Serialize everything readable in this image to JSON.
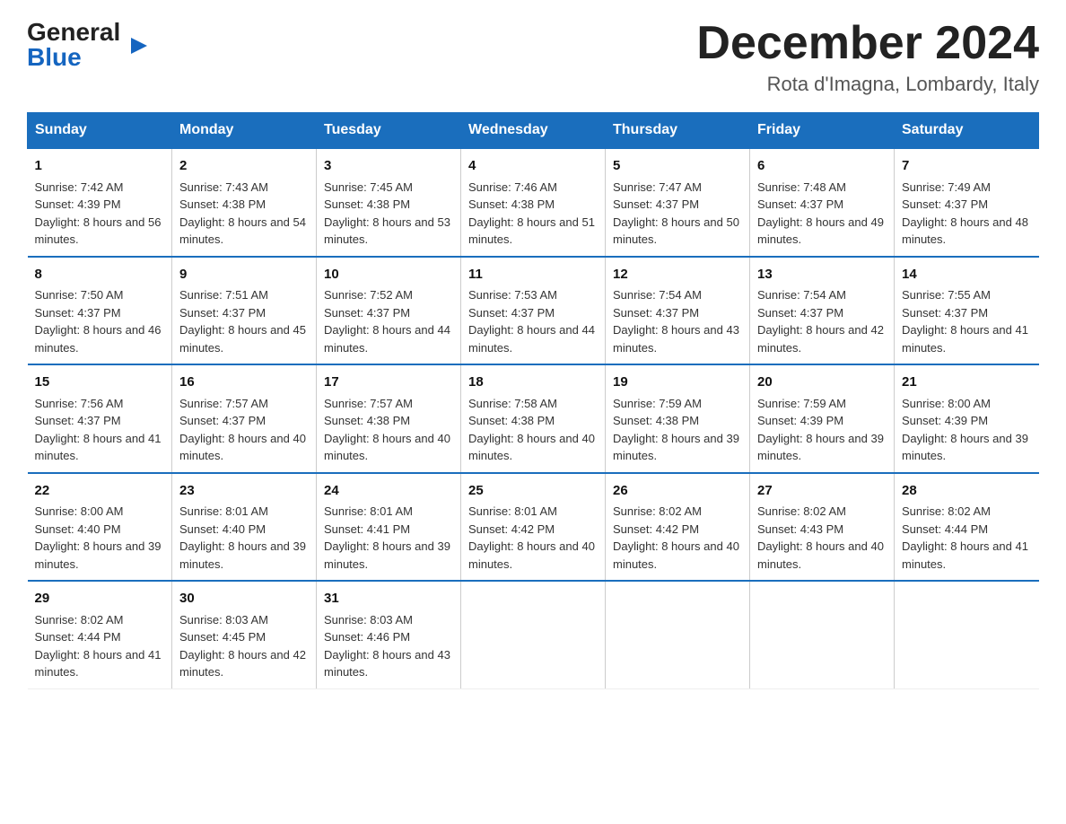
{
  "logo": {
    "line1": "General",
    "arrow": "▶",
    "line2": "Blue"
  },
  "title": "December 2024",
  "location": "Rota d'Imagna, Lombardy, Italy",
  "days_of_week": [
    "Sunday",
    "Monday",
    "Tuesday",
    "Wednesday",
    "Thursday",
    "Friday",
    "Saturday"
  ],
  "weeks": [
    [
      {
        "day": "1",
        "sunrise": "7:42 AM",
        "sunset": "4:39 PM",
        "daylight": "8 hours and 56 minutes."
      },
      {
        "day": "2",
        "sunrise": "7:43 AM",
        "sunset": "4:38 PM",
        "daylight": "8 hours and 54 minutes."
      },
      {
        "day": "3",
        "sunrise": "7:45 AM",
        "sunset": "4:38 PM",
        "daylight": "8 hours and 53 minutes."
      },
      {
        "day": "4",
        "sunrise": "7:46 AM",
        "sunset": "4:38 PM",
        "daylight": "8 hours and 51 minutes."
      },
      {
        "day": "5",
        "sunrise": "7:47 AM",
        "sunset": "4:37 PM",
        "daylight": "8 hours and 50 minutes."
      },
      {
        "day": "6",
        "sunrise": "7:48 AM",
        "sunset": "4:37 PM",
        "daylight": "8 hours and 49 minutes."
      },
      {
        "day": "7",
        "sunrise": "7:49 AM",
        "sunset": "4:37 PM",
        "daylight": "8 hours and 48 minutes."
      }
    ],
    [
      {
        "day": "8",
        "sunrise": "7:50 AM",
        "sunset": "4:37 PM",
        "daylight": "8 hours and 46 minutes."
      },
      {
        "day": "9",
        "sunrise": "7:51 AM",
        "sunset": "4:37 PM",
        "daylight": "8 hours and 45 minutes."
      },
      {
        "day": "10",
        "sunrise": "7:52 AM",
        "sunset": "4:37 PM",
        "daylight": "8 hours and 44 minutes."
      },
      {
        "day": "11",
        "sunrise": "7:53 AM",
        "sunset": "4:37 PM",
        "daylight": "8 hours and 44 minutes."
      },
      {
        "day": "12",
        "sunrise": "7:54 AM",
        "sunset": "4:37 PM",
        "daylight": "8 hours and 43 minutes."
      },
      {
        "day": "13",
        "sunrise": "7:54 AM",
        "sunset": "4:37 PM",
        "daylight": "8 hours and 42 minutes."
      },
      {
        "day": "14",
        "sunrise": "7:55 AM",
        "sunset": "4:37 PM",
        "daylight": "8 hours and 41 minutes."
      }
    ],
    [
      {
        "day": "15",
        "sunrise": "7:56 AM",
        "sunset": "4:37 PM",
        "daylight": "8 hours and 41 minutes."
      },
      {
        "day": "16",
        "sunrise": "7:57 AM",
        "sunset": "4:37 PM",
        "daylight": "8 hours and 40 minutes."
      },
      {
        "day": "17",
        "sunrise": "7:57 AM",
        "sunset": "4:38 PM",
        "daylight": "8 hours and 40 minutes."
      },
      {
        "day": "18",
        "sunrise": "7:58 AM",
        "sunset": "4:38 PM",
        "daylight": "8 hours and 40 minutes."
      },
      {
        "day": "19",
        "sunrise": "7:59 AM",
        "sunset": "4:38 PM",
        "daylight": "8 hours and 39 minutes."
      },
      {
        "day": "20",
        "sunrise": "7:59 AM",
        "sunset": "4:39 PM",
        "daylight": "8 hours and 39 minutes."
      },
      {
        "day": "21",
        "sunrise": "8:00 AM",
        "sunset": "4:39 PM",
        "daylight": "8 hours and 39 minutes."
      }
    ],
    [
      {
        "day": "22",
        "sunrise": "8:00 AM",
        "sunset": "4:40 PM",
        "daylight": "8 hours and 39 minutes."
      },
      {
        "day": "23",
        "sunrise": "8:01 AM",
        "sunset": "4:40 PM",
        "daylight": "8 hours and 39 minutes."
      },
      {
        "day": "24",
        "sunrise": "8:01 AM",
        "sunset": "4:41 PM",
        "daylight": "8 hours and 39 minutes."
      },
      {
        "day": "25",
        "sunrise": "8:01 AM",
        "sunset": "4:42 PM",
        "daylight": "8 hours and 40 minutes."
      },
      {
        "day": "26",
        "sunrise": "8:02 AM",
        "sunset": "4:42 PM",
        "daylight": "8 hours and 40 minutes."
      },
      {
        "day": "27",
        "sunrise": "8:02 AM",
        "sunset": "4:43 PM",
        "daylight": "8 hours and 40 minutes."
      },
      {
        "day": "28",
        "sunrise": "8:02 AM",
        "sunset": "4:44 PM",
        "daylight": "8 hours and 41 minutes."
      }
    ],
    [
      {
        "day": "29",
        "sunrise": "8:02 AM",
        "sunset": "4:44 PM",
        "daylight": "8 hours and 41 minutes."
      },
      {
        "day": "30",
        "sunrise": "8:03 AM",
        "sunset": "4:45 PM",
        "daylight": "8 hours and 42 minutes."
      },
      {
        "day": "31",
        "sunrise": "8:03 AM",
        "sunset": "4:46 PM",
        "daylight": "8 hours and 43 minutes."
      },
      null,
      null,
      null,
      null
    ]
  ]
}
